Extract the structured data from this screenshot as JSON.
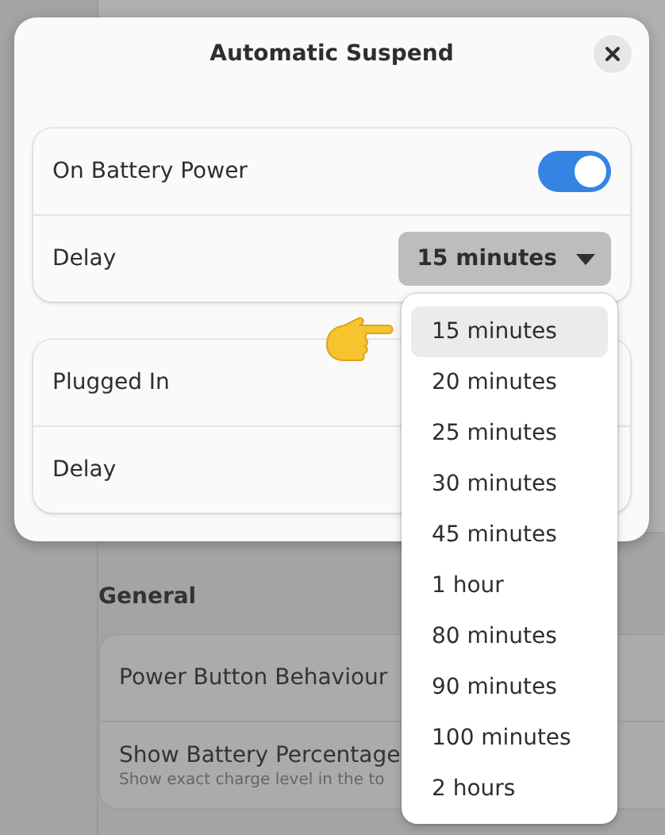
{
  "background": {
    "heading": "General",
    "rows": [
      {
        "title": "Power Button Behaviour"
      },
      {
        "title": "Show Battery Percentage",
        "subtitle": "Show exact charge level in the to"
      }
    ]
  },
  "dialog": {
    "title": "Automatic Suspend",
    "sections": [
      {
        "rows": [
          {
            "kind": "switch",
            "label": "On Battery Power",
            "on": true
          },
          {
            "kind": "dropdown",
            "label": "Delay",
            "value": "15 minutes"
          }
        ]
      },
      {
        "rows": [
          {
            "kind": "plain",
            "label": "Plugged In"
          },
          {
            "kind": "plain",
            "label": "Delay"
          }
        ]
      }
    ]
  },
  "popover": {
    "options": [
      {
        "label": "15 minutes",
        "selected": true
      },
      {
        "label": "20 minutes",
        "selected": false
      },
      {
        "label": "25 minutes",
        "selected": false
      },
      {
        "label": "30 minutes",
        "selected": false
      },
      {
        "label": "45 minutes",
        "selected": false
      },
      {
        "label": "1 hour",
        "selected": false
      },
      {
        "label": "80 minutes",
        "selected": false
      },
      {
        "label": "90 minutes",
        "selected": false
      },
      {
        "label": "100 minutes",
        "selected": false
      },
      {
        "label": "2 hours",
        "selected": false
      }
    ]
  }
}
